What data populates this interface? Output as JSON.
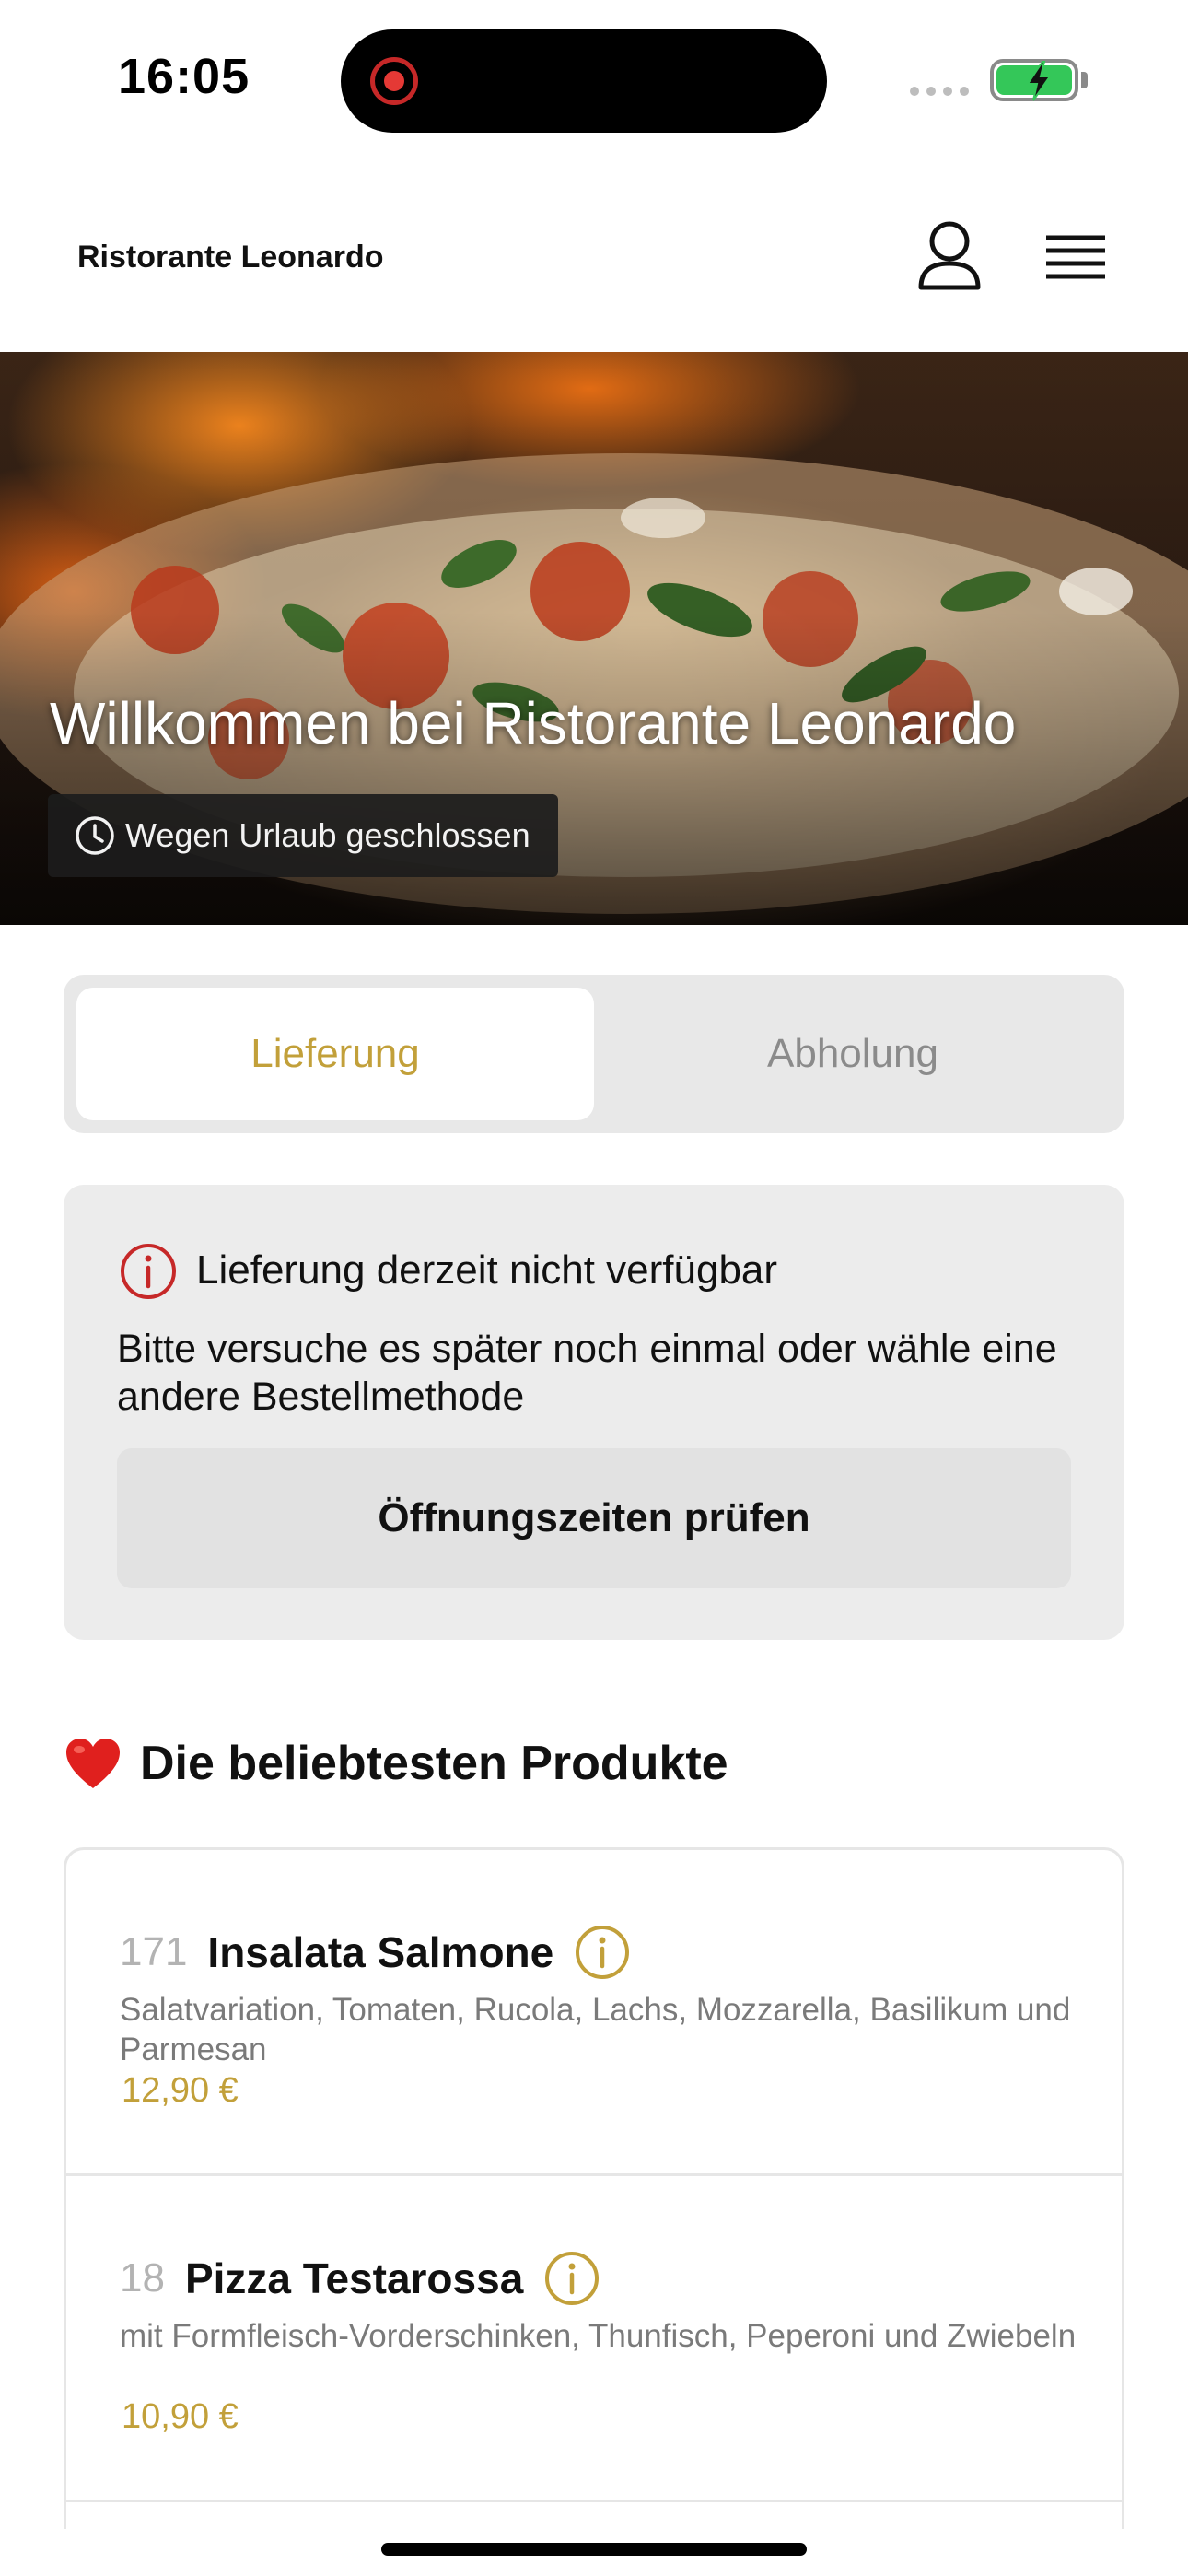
{
  "status_bar": {
    "time": "16:05"
  },
  "header": {
    "brand": "Ristorante Leonardo"
  },
  "hero": {
    "title": "Willkommen bei Ristorante Leonardo",
    "status_badge": "Wegen Urlaub geschlossen"
  },
  "order_mode": {
    "tabs": [
      {
        "label": "Lieferung",
        "selected": true
      },
      {
        "label": "Abholung",
        "selected": false
      }
    ]
  },
  "alert": {
    "title": "Lieferung derzeit nicht verfügbar",
    "body": "Bitte versuche es später noch einmal oder wähle eine andere Bestellmethode",
    "button_label": "Öffnungszeiten prüfen"
  },
  "popular": {
    "title": "Die beliebtesten Produkte",
    "products": [
      {
        "number": "171",
        "name": "Insalata Salmone",
        "description": "Salatvariation, Tomaten, Rucola, Lachs, Mozzarella, Basilikum und Parmesan",
        "price": "12,90 €"
      },
      {
        "number": "18",
        "name": "Pizza Testarossa",
        "description": "mit Formfleisch-Vorderschinken, Thunfisch, Peperoni und Zwiebeln",
        "price": "10,90 €"
      }
    ]
  },
  "colors": {
    "accent": "#c2a03a",
    "alert_red": "#c62828",
    "card_bg": "#ececec"
  },
  "icons": [
    "record-icon",
    "battery-icon",
    "user-icon",
    "menu-icon",
    "clock-icon",
    "alert-info-icon",
    "heart-icon",
    "info-icon"
  ]
}
